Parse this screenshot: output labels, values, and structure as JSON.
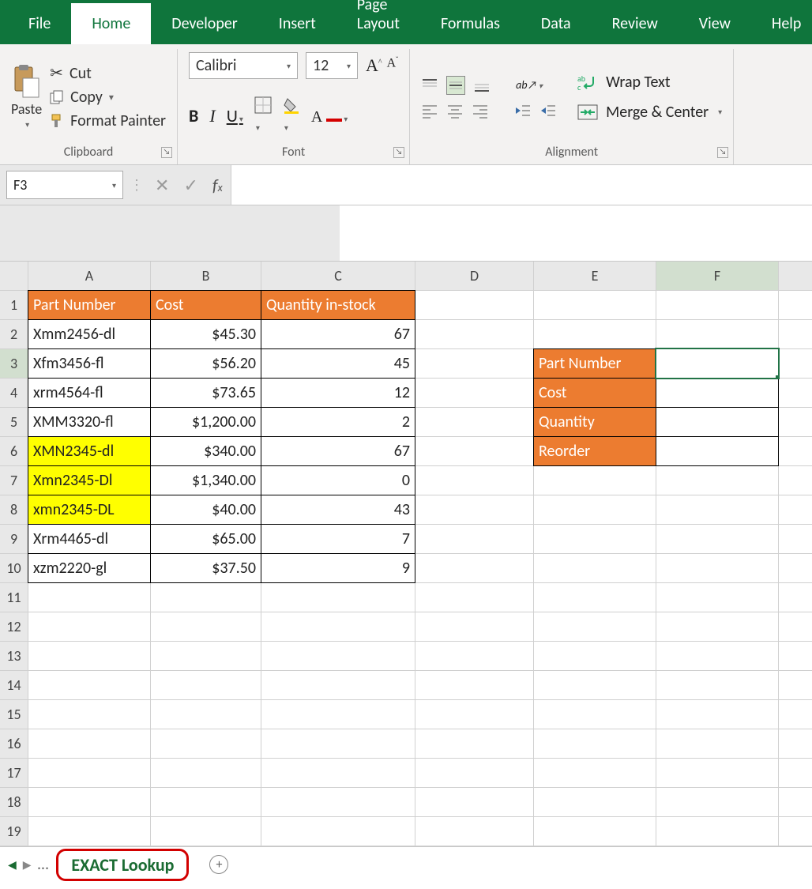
{
  "tabs": {
    "file": "File",
    "home": "Home",
    "developer": "Developer",
    "insert": "Insert",
    "page_layout": "Page Layout",
    "formulas": "Formulas",
    "data": "Data",
    "review": "Review",
    "view": "View",
    "help": "Help"
  },
  "ribbon": {
    "clipboard": {
      "paste": "Paste",
      "cut": "Cut",
      "copy": "Copy",
      "format_painter": "Format Painter",
      "label": "Clipboard"
    },
    "font": {
      "name": "Calibri",
      "size": "12",
      "label": "Font"
    },
    "alignment": {
      "wrap": "Wrap Text",
      "merge": "Merge & Center",
      "label": "Alignment"
    }
  },
  "namebox": "F3",
  "sheet": {
    "cols": [
      "A",
      "B",
      "C",
      "D",
      "E",
      "F"
    ],
    "rows": [
      "1",
      "2",
      "3",
      "4",
      "5",
      "6",
      "7",
      "8",
      "9",
      "10",
      "11",
      "12",
      "13",
      "14",
      "15",
      "16",
      "17",
      "18",
      "19"
    ],
    "headers": {
      "A1": "Part Number",
      "B1": "Cost",
      "C1": "Quantity in-stock"
    },
    "data": [
      {
        "part": "Xmm2456-dl",
        "cost": "$45.30",
        "qty": "67",
        "hl": false
      },
      {
        "part": "Xfm3456-fl",
        "cost": "$56.20",
        "qty": "45",
        "hl": false
      },
      {
        "part": "xrm4564-fl",
        "cost": "$73.65",
        "qty": "12",
        "hl": false
      },
      {
        "part": "XMM3320-fl",
        "cost": "$1,200.00",
        "qty": "2",
        "hl": false
      },
      {
        "part": "XMN2345-dl",
        "cost": "$340.00",
        "qty": "67",
        "hl": true
      },
      {
        "part": "Xmn2345-Dl",
        "cost": "$1,340.00",
        "qty": "0",
        "hl": true
      },
      {
        "part": "xmn2345-DL",
        "cost": "$40.00",
        "qty": "43",
        "hl": true
      },
      {
        "part": "Xrm4465-dl",
        "cost": "$65.00",
        "qty": "7",
        "hl": false
      },
      {
        "part": "xzm2220-gl",
        "cost": "$37.50",
        "qty": "9",
        "hl": false
      }
    ],
    "lookup": {
      "E3": "Part Number",
      "E4": "Cost",
      "E5": "Quantity",
      "E6": "Reorder"
    }
  },
  "sheet_tab": "EXACT Lookup",
  "selected_cell": "F3",
  "selected_col": "F",
  "selected_row": "3"
}
